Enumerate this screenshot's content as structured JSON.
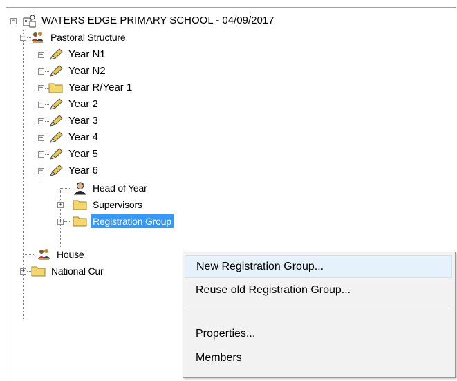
{
  "tree": {
    "root": "WATERS EDGE PRIMARY SCHOOL - 04/09/2017",
    "pastoral": "Pastoral Structure",
    "years": [
      "Year N1",
      "Year  N2",
      "Year  R/Year  1",
      "Year  2",
      "Year  3",
      "Year  4",
      "Year  5",
      "Year  6"
    ],
    "year6_children": [
      "Head of Year",
      "Supervisors",
      "Registration Group"
    ],
    "house": "House",
    "national": "National Cur"
  },
  "context_menu": {
    "items": [
      "New Registration Group...",
      "Reuse old Registration Group...",
      "Properties...",
      "Members"
    ]
  },
  "colors": {
    "selection": "#3399ff",
    "menu_hover": "#e5f1fb",
    "pencil": "#e8c84a",
    "folder": "#f5d66b"
  }
}
